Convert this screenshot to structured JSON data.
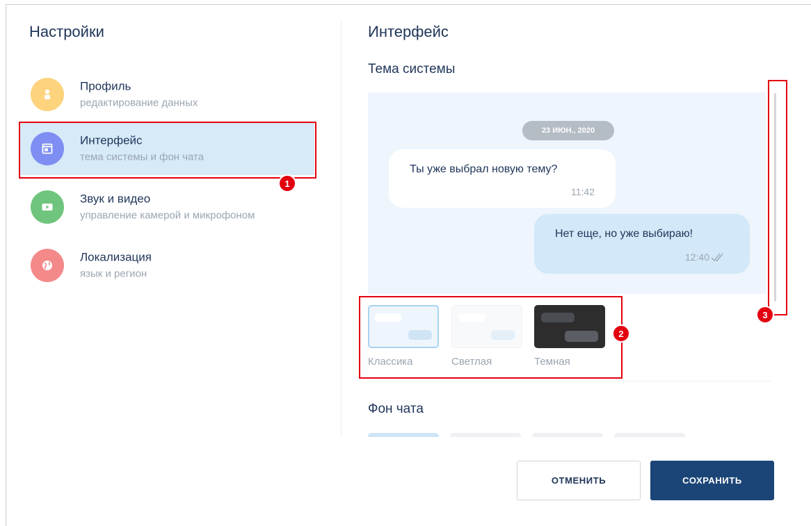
{
  "sidebar": {
    "title": "Настройки",
    "items": [
      {
        "title": "Профиль",
        "subtitle": "редактирование данных",
        "icon": "user-icon",
        "color": "#fdd37e"
      },
      {
        "title": "Интерфейс",
        "subtitle": "тема системы и фон чата",
        "icon": "window-icon",
        "color": "#7e8ef2",
        "active": true
      },
      {
        "title": "Звук и видео",
        "subtitle": "управление камерой и микрофоном",
        "icon": "play-icon",
        "color": "#6fc57d"
      },
      {
        "title": "Локализация",
        "subtitle": "язык и регион",
        "icon": "globe-icon",
        "color": "#f4898a"
      }
    ]
  },
  "main": {
    "title": "Интерфейс",
    "theme_section": "Тема системы",
    "preview": {
      "date": "23 ИЮН., 2020",
      "incoming": {
        "text": "Ты уже выбрал новую тему?",
        "time": "11:42"
      },
      "outgoing": {
        "text": "Нет еще, но уже выбираю!",
        "time": "12:40"
      }
    },
    "themes": [
      {
        "label": "Классика",
        "selected": true
      },
      {
        "label": "Светлая"
      },
      {
        "label": "Темная"
      }
    ],
    "background_section": "Фон чата"
  },
  "buttons": {
    "cancel": "ОТМЕНИТЬ",
    "save": "СОХРАНИТЬ"
  },
  "annotations": [
    "1",
    "2",
    "3"
  ],
  "colors": {
    "accent": "#1c4577",
    "highlight": "#e3000f",
    "active_bg": "#d6eaf8"
  }
}
